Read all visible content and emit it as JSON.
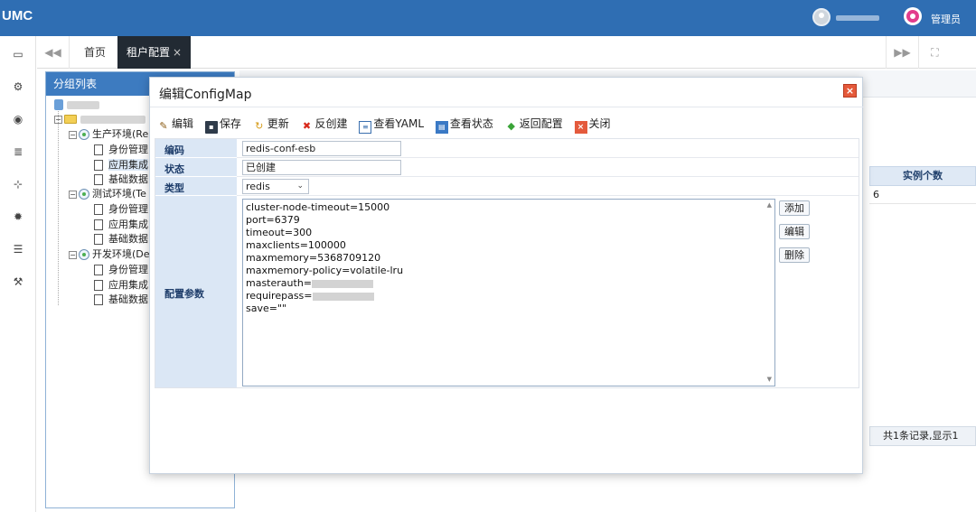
{
  "app": {
    "brand": "UMC",
    "admin_label": "管理员"
  },
  "topbar_icons": [
    "user-avatar-icon",
    "admin-location-icon"
  ],
  "rail_icons": [
    "id-card-icon",
    "gears-icon",
    "eye-icon",
    "server-icon",
    "sitemap-icon",
    "gear-icon",
    "list-icon",
    "wrench-icon"
  ],
  "tabs": {
    "nav_prev": "◀◀",
    "home": "首页",
    "active": "租户配置",
    "close": "×",
    "nav_next": "▶▶",
    "fullscreen": "⛶"
  },
  "group_panel": {
    "title": "分组列表",
    "tree": [
      {
        "label": "生产环境(Re"
      },
      {
        "label": "身份管理"
      },
      {
        "label": "应用集成"
      },
      {
        "label": "基础数据"
      },
      {
        "label": "测试环境(Te"
      },
      {
        "label": "身份管理"
      },
      {
        "label": "应用集成"
      },
      {
        "label": "基础数据"
      },
      {
        "label": "开发环境(De"
      },
      {
        "label": "身份管理"
      },
      {
        "label": "应用集成"
      },
      {
        "label": "基础数据"
      }
    ]
  },
  "background_grid": {
    "column_header": "实例个数",
    "cell_value": "6",
    "pager_text": "共1条记录,显示1"
  },
  "dialog": {
    "title": "编辑ConfigMap",
    "close": "×",
    "toolbar": [
      {
        "label": "编辑",
        "icon": "pencil-icon"
      },
      {
        "label": "保存",
        "icon": "save-icon"
      },
      {
        "label": "更新",
        "icon": "refresh-icon"
      },
      {
        "label": "反创建",
        "icon": "cross-icon"
      },
      {
        "label": "查看YAML",
        "icon": "document-icon"
      },
      {
        "label": "查看状态",
        "icon": "monitor-icon"
      },
      {
        "label": "返回配置",
        "icon": "back-arrow-icon"
      },
      {
        "label": "关闭",
        "icon": "close-icon"
      }
    ],
    "fields": {
      "code_label": "编码",
      "code_value": "redis-conf-esb",
      "status_label": "状态",
      "status_value": "已创建",
      "type_label": "类型",
      "type_value": "redis",
      "params_label": "配置参数"
    },
    "params_lines": [
      "cluster-node-timeout=15000",
      "port=6379",
      "timeout=300",
      "maxclients=100000",
      "maxmemory=5368709120",
      "maxmemory-policy=volatile-lru",
      "masterauth=",
      "requirepass=",
      "save=\"\""
    ],
    "side_buttons": {
      "add": "添加",
      "edit": "编辑",
      "delete": "删除"
    }
  }
}
